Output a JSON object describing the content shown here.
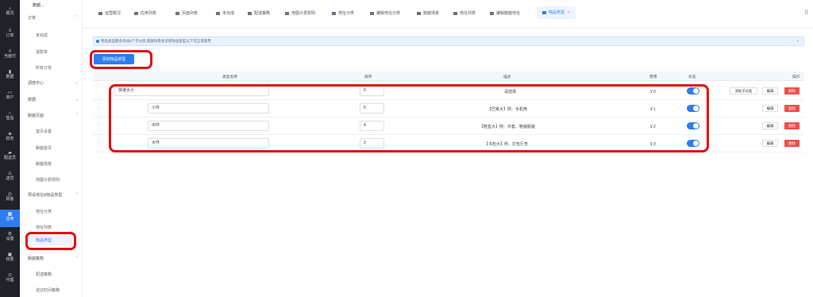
{
  "colors": {
    "primary": "#2d7cf2",
    "danger": "#ef4e4e",
    "rail_bg": "#1f2228",
    "highlight": "#e01010"
  },
  "rail": {
    "items": [
      {
        "label": "概况",
        "icon": "home-icon"
      },
      {
        "label": "订单",
        "icon": "list-icon"
      },
      {
        "label": "当面付",
        "icon": "list-icon"
      },
      {
        "label": "数据",
        "icon": "chart-icon"
      },
      {
        "label": "商户",
        "icon": "shop-icon"
      },
      {
        "label": "售后",
        "icon": "headset-icon"
      },
      {
        "label": "财务",
        "icon": "wallet-icon"
      },
      {
        "label": "配送员",
        "icon": "truck-icon"
      },
      {
        "label": "送员",
        "icon": "user-icon"
      },
      {
        "label": "顾客",
        "icon": "target-icon"
      },
      {
        "label": "应用",
        "icon": "apps-icon"
      },
      {
        "label": "设置",
        "icon": "gear-icon"
      },
      {
        "label": "权限",
        "icon": "lock-icon"
      },
      {
        "label": "代理",
        "icon": "agent-icon"
      }
    ]
  },
  "submenu": {
    "title": "跑腿...",
    "groups": [
      {
        "label": "订单"
      },
      {
        "label": "调度中心"
      },
      {
        "label": "数据"
      },
      {
        "label": "跑腿页面"
      },
      {
        "label": "预设地址&物品类型"
      },
      {
        "label": "跑腿策略"
      }
    ],
    "items": [
      "未完成",
      "退款单",
      "所有订单",
      "首页设置",
      "跑腿首页",
      "跑腿场景",
      "地图计费规则",
      "地址分类",
      "地址列表",
      "物品类型",
      "配送策略",
      "送达时间策略"
    ]
  },
  "tabs": [
    {
      "label": "运营概况"
    },
    {
      "label": "应用列表"
    },
    {
      "label": "页面列表"
    },
    {
      "label": "未完成"
    },
    {
      "label": "配送策略"
    },
    {
      "label": "地图计费规则"
    },
    {
      "label": "地址分类"
    },
    {
      "label": "编辑地址分类"
    },
    {
      "label": "跑腿场景"
    },
    {
      "label": "地址列表"
    },
    {
      "label": "编辑跑腿地址"
    },
    {
      "label": "物品类型"
    }
  ],
  "alert": {
    "text": "物品类型最多添加5个子分类,跑腿场景会读取物品类型以下可正常使用"
  },
  "actions": {
    "add_label": "添加物品类型"
  },
  "table": {
    "headers": {
      "name": "类型名称",
      "sort": "排序",
      "desc": "描述",
      "fee": "费用",
      "status": "状态",
      "ops": "操作"
    },
    "rows": [
      {
        "name": "快递大小",
        "sort": "0",
        "desc": "请选择",
        "fee": "￥0",
        "status": true,
        "add_child": "添加子分类",
        "edit": "编辑",
        "delete": "删除"
      },
      {
        "name": "小件",
        "sort": "5",
        "desc": "【巴掌大】例：手机壳",
        "fee": "￥1",
        "status": true,
        "edit": "编辑",
        "delete": "删除"
      },
      {
        "name": "中件",
        "sort": "4",
        "desc": "【鞋盒大】例：外套、鞋装服装",
        "fee": "￥2",
        "status": true,
        "edit": "编辑",
        "delete": "删除"
      },
      {
        "name": "大件",
        "sort": "3",
        "desc": "【书包大】例：打包行李",
        "fee": "￥3",
        "status": true,
        "edit": "编辑",
        "delete": "删除"
      }
    ]
  }
}
